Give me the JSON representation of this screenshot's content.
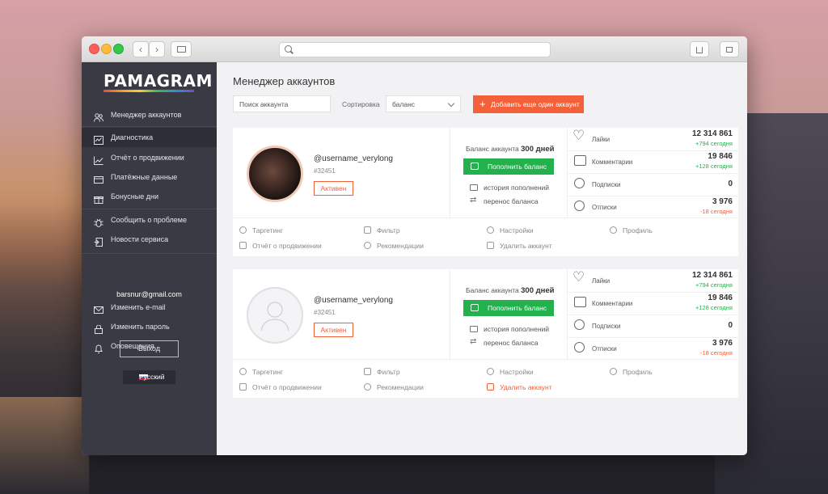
{
  "sidebar": {
    "logo": "PAMAGRAM",
    "nav": [
      {
        "label": "Менеджер аккаунтов",
        "icon": "users-icon"
      },
      {
        "label": "Диагностика",
        "icon": "diagnostics-icon"
      },
      {
        "label": "Отчёт о продвижении",
        "icon": "chart-icon"
      },
      {
        "label": "Платёжные данные",
        "icon": "card-icon"
      },
      {
        "label": "Бонусные дни",
        "icon": "gift-icon"
      },
      {
        "label": "Сообщить о проблеме",
        "icon": "bug-icon"
      },
      {
        "label": "Новости сервиса",
        "icon": "news-icon"
      }
    ],
    "account": {
      "email": "barsnur@gmail.com",
      "items": [
        {
          "label": "Изменить e-mail",
          "icon": "mail-icon"
        },
        {
          "label": "Изменить пароль",
          "icon": "lock-icon"
        },
        {
          "label": "Оповещения",
          "icon": "bell-icon"
        }
      ]
    },
    "logout": "Выход",
    "language": "Русский"
  },
  "main": {
    "title": "Менеджер аккаунтов",
    "search_placeholder": "Поиск аккаунта",
    "sort_label": "Сортировка",
    "sort_value": "баланс",
    "add_button": "Добавить еще один аккаунт"
  },
  "accounts": [
    {
      "username": "@username_verylong",
      "id": "#32451",
      "status": "Активен",
      "balance_label": "Баланс аккаунта",
      "balance_value": "300 дней",
      "topup": "Пополнить баланс",
      "history": "история пополнений",
      "transfer": "перенос баланса",
      "stats": [
        {
          "label": "Лайки",
          "value": "12 314 861",
          "delta": "+794 сегодня",
          "trend": "up",
          "icon": "heart-icon"
        },
        {
          "label": "Комментарии",
          "value": "19 846",
          "delta": "+128 сегодня",
          "trend": "up",
          "icon": "comment-icon"
        },
        {
          "label": "Подписки",
          "value": "0",
          "delta": "",
          "trend": "",
          "icon": "follow-icon"
        },
        {
          "label": "Отписки",
          "value": "3 976",
          "delta": "-18 сегодня",
          "trend": "down",
          "icon": "unfollow-icon"
        }
      ],
      "actions": [
        "Таргетинг",
        "Фильтр",
        "Настройки",
        "Профиль",
        "Отчёт о продвижении",
        "Рекомендации",
        "Удалить аккаунт"
      ]
    },
    {
      "username": "@username_verylong",
      "id": "#32451",
      "status": "Активен",
      "balance_label": "Баланс аккаунта",
      "balance_value": "300 дней",
      "topup": "Пополнить баланс",
      "history": "история пополнений",
      "transfer": "перенос баланса",
      "stats": [
        {
          "label": "Лайки",
          "value": "12 314 861",
          "delta": "+794 сегодня",
          "trend": "up",
          "icon": "heart-icon"
        },
        {
          "label": "Комментарии",
          "value": "19 846",
          "delta": "+128 сегодня",
          "trend": "up",
          "icon": "comment-icon"
        },
        {
          "label": "Подписки",
          "value": "0",
          "delta": "",
          "trend": "",
          "icon": "follow-icon"
        },
        {
          "label": "Отписки",
          "value": "3 976",
          "delta": "-18 сегодня",
          "trend": "down",
          "icon": "unfollow-icon"
        }
      ],
      "actions": [
        "Таргетинг",
        "Фильтр",
        "Настройки",
        "Профиль",
        "Отчёт о продвижении",
        "Рекомендации",
        "Удалить аккаунт"
      ]
    }
  ],
  "colors": {
    "accent": "#f4603a",
    "success": "#22b14c",
    "sidebar_bg": "#393a43"
  }
}
